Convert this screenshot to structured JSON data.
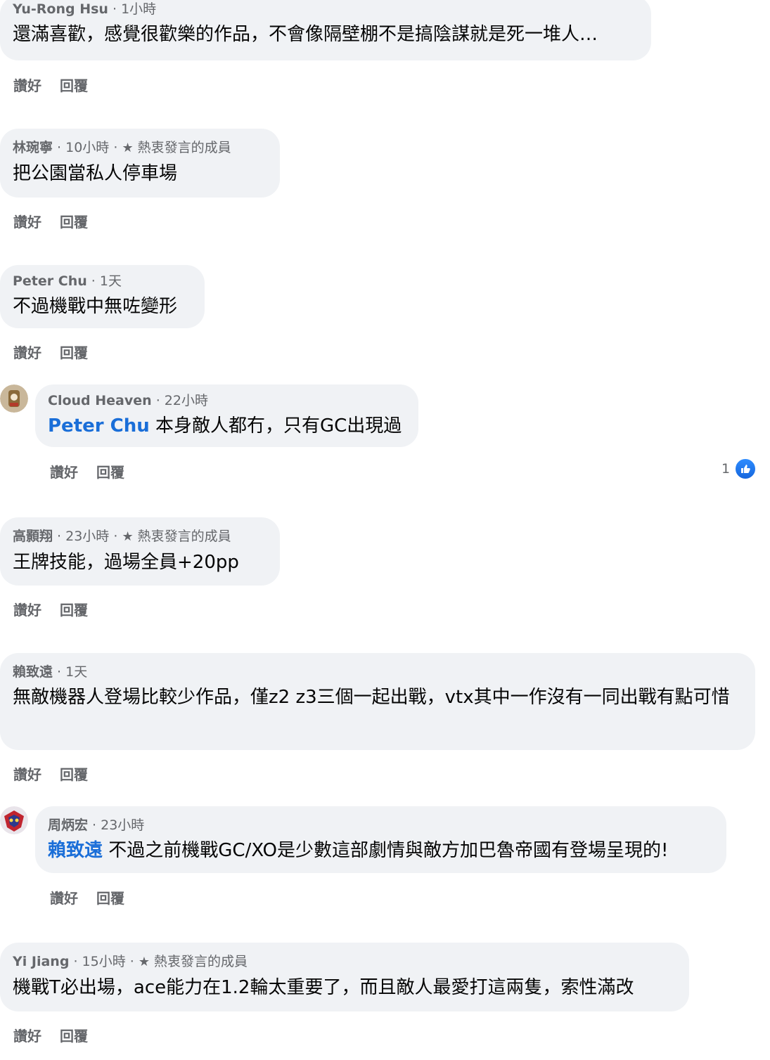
{
  "comments": [
    {
      "author": "Yu-Rong Hsu",
      "time": " · 1小時",
      "badge": "",
      "mention": "",
      "text": "還滿喜歡，感覺很歡樂的作品，不會像隔壁棚不是搞陰謀就是死一堆人…",
      "like": "讚好",
      "reply": "回覆"
    },
    {
      "author": "林琬寧",
      "time": " · 10小時 · ",
      "badge": "熱衷發言的成員",
      "mention": "",
      "text": "把公園當私人停車場",
      "like": "讚好",
      "reply": "回覆"
    },
    {
      "author": "Peter Chu",
      "time": " · 1天",
      "badge": "",
      "mention": "",
      "text": "不過機戰中無咗變形",
      "like": "讚好",
      "reply": "回覆"
    },
    {
      "author": "Cloud Heaven",
      "time": " · 22小時",
      "badge": "",
      "mention": "Peter Chu",
      "text": " 本身敵人都冇，只有GC出現過",
      "like": "讚好",
      "reply": "回覆",
      "reaction_count": "1"
    },
    {
      "author": "高顥翔",
      "time": " · 23小時 · ",
      "badge": "熱衷發言的成員",
      "mention": "",
      "text": "王牌技能，過場全員+20pp",
      "like": "讚好",
      "reply": "回覆"
    },
    {
      "author": "賴致遠",
      "time": " · 1天",
      "badge": "",
      "mention": "",
      "text": "無敵機器人登場比較少作品，僅z2 z3三個一起出戰，vtx其中一作沒有一同出戰有點可惜",
      "like": "讚好",
      "reply": "回覆"
    },
    {
      "author": "周炳宏",
      "time": " · 23小時",
      "badge": "",
      "mention": "賴致遠",
      "text": " 不過之前機戰GC/XO是少數這部劇情與敵方加巴魯帝國有登場呈現的!",
      "like": "讚好",
      "reply": "回覆"
    },
    {
      "author": "Yi Jiang",
      "time": " · 15小時 · ",
      "badge": "熱衷發言的成員",
      "mention": "",
      "text": "機戰T必出場，ace能力在1.2輪太重要了，而且敵人最愛打這兩隻，索性滿改",
      "like": "讚好",
      "reply": "回覆"
    }
  ],
  "icons": {
    "badge": "star-icon",
    "reaction": "thumbs-up-icon",
    "accent": "#1a6ed8",
    "bubble_bg": "#f0f2f5"
  }
}
